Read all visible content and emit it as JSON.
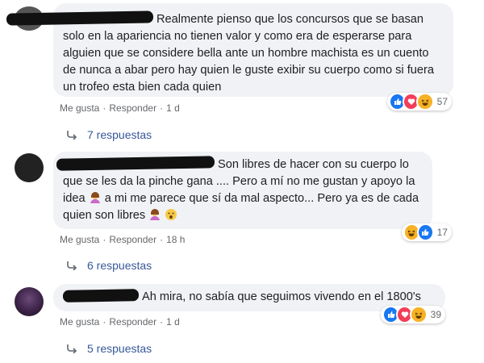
{
  "comments": [
    {
      "text": "Realmente pienso que los concursos que se basan solo en la apariencia no tienen valor y como era de esperarse para alguien que se considere bella ante un hombre machista es un cuento de nunca a abar pero hay quien le guste exibir su cuerpo como si fuera un trofeo esta bien cada quien",
      "actions": {
        "like": "Me gusta",
        "reply": "Responder",
        "time": "1 d"
      },
      "reactions": {
        "icons": [
          "like-icon",
          "love-icon",
          "haha-icon"
        ],
        "count": "57"
      },
      "replies": "7 respuestas"
    },
    {
      "text_parts": [
        "Son libres de hacer con su cuerpo lo que se les da la pinche gana .... Pero a mí no me gustan y apoyo la idea ",
        " a mi me parece que sí da mal aspecto... Pero ya es de cada quien son libres "
      ],
      "actions": {
        "like": "Me gusta",
        "reply": "Responder",
        "time": "18 h"
      },
      "reactions": {
        "icons": [
          "haha-icon",
          "like-icon"
        ],
        "count": "17"
      },
      "replies": "6 respuestas"
    },
    {
      "text": "Ah mira, no sabía que seguimos vivendo en el 1800's",
      "actions": {
        "like": "Me gusta",
        "reply": "Responder",
        "time": "1 d"
      },
      "reactions": {
        "icons": [
          "like-icon",
          "love-icon",
          "haha-icon"
        ],
        "count": "39"
      },
      "replies": "5 respuestas"
    }
  ],
  "colors": {
    "bubble": "#f0f2f5",
    "meta": "#65676b",
    "link": "#385898",
    "like": "#1877f2",
    "love": "#f33e58",
    "haha": "#f7b125"
  }
}
